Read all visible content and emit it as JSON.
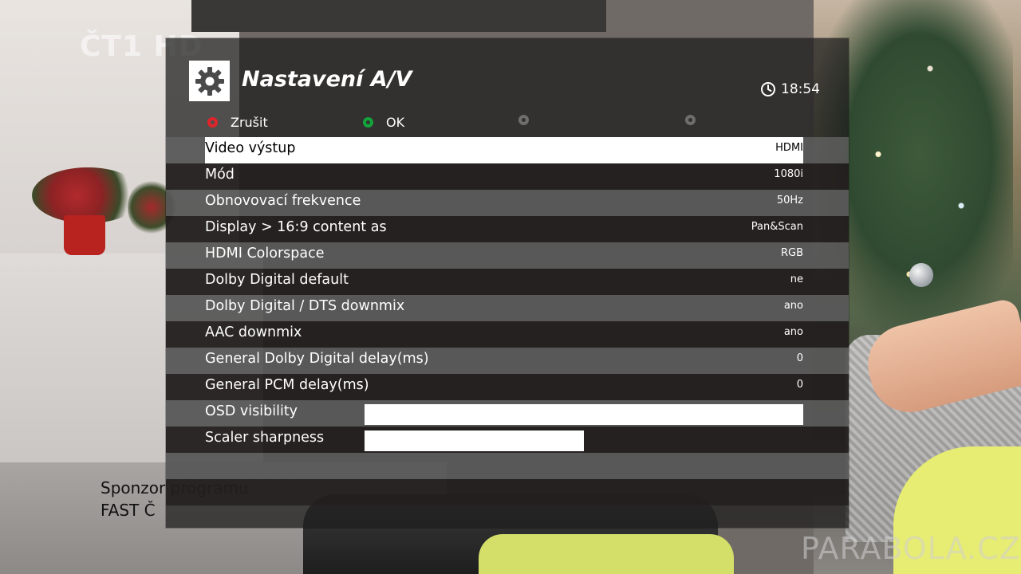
{
  "screen": {
    "channel_logo": "ČT1 HD",
    "sponsor_line1": "Sponzor programu",
    "sponsor_line2": "FAST Č",
    "watermark": "PARABOLA.CZ"
  },
  "menu": {
    "title": "Nastavení A/V",
    "icon": "gear-icon",
    "clock": {
      "icon": "clock-icon",
      "time": "18:54"
    },
    "softkeys": [
      {
        "color": "#e0242a",
        "label": "Zrušit"
      },
      {
        "color": "#12a43b",
        "label": "OK"
      },
      {
        "color": "#6e6e6e",
        "label": ""
      },
      {
        "color": "#6e6e6e",
        "label": ""
      }
    ],
    "items": [
      {
        "label": "Video výstup",
        "value": "HDMI",
        "selected": true
      },
      {
        "label": "Mód",
        "value": "1080i"
      },
      {
        "label": "Obnovovací frekvence",
        "value": "50Hz"
      },
      {
        "label": "Display > 16:9 content as",
        "value": "Pan&Scan"
      },
      {
        "label": "HDMI Colorspace",
        "value": "RGB"
      },
      {
        "label": "Dolby Digital default",
        "value": "ne"
      },
      {
        "label": "Dolby Digital / DTS downmix",
        "value": "ano"
      },
      {
        "label": "AAC downmix",
        "value": "ano"
      },
      {
        "label": "General Dolby Digital delay(ms)",
        "value": "0"
      },
      {
        "label": "General PCM delay(ms)",
        "value": "0"
      },
      {
        "label": "OSD visibility",
        "slider_level": 1.0
      },
      {
        "label": "Scaler sharpness",
        "slider_level": 0.5
      }
    ]
  },
  "colors": {
    "selection": "#ffffff",
    "text": "#ffffff",
    "cancel_key": "#e0242a",
    "ok_key": "#12a43b"
  }
}
